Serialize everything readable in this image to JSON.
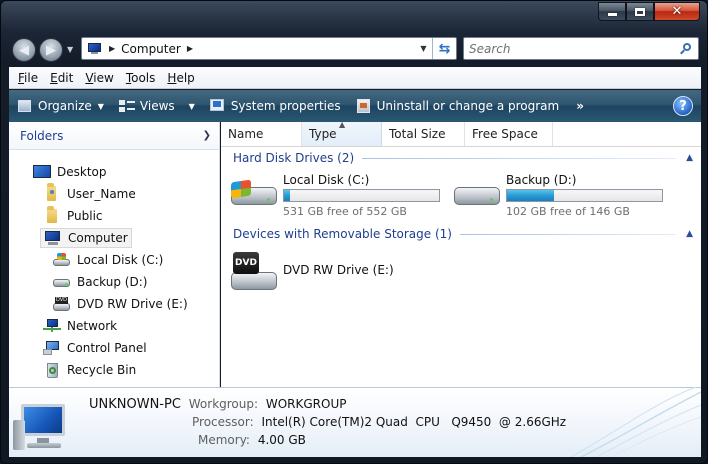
{
  "window": {
    "caption_buttons": [
      "minimize",
      "maximize",
      "close"
    ]
  },
  "address": {
    "crumbs": [
      "Computer"
    ],
    "search_placeholder": "Search"
  },
  "menu": {
    "items": [
      {
        "label": "File",
        "accel": "F",
        "rest": "ile"
      },
      {
        "label": "Edit",
        "accel": "E",
        "rest": "dit"
      },
      {
        "label": "View",
        "accel": "V",
        "rest": "iew"
      },
      {
        "label": "Tools",
        "accel": "T",
        "rest": "ools"
      },
      {
        "label": "Help",
        "accel": "H",
        "rest": "elp"
      }
    ]
  },
  "toolbar": {
    "organize": "Organize",
    "views": "Views",
    "system_properties": "System properties",
    "uninstall": "Uninstall or change a program",
    "more": "»",
    "help": "?"
  },
  "nav": {
    "header": "Folders",
    "items": [
      {
        "label": "Desktop",
        "icon": "desktop-icon"
      },
      {
        "label": "User_Name",
        "icon": "user-folder-icon"
      },
      {
        "label": "Public",
        "icon": "folder-icon"
      },
      {
        "label": "Computer",
        "icon": "computer-icon",
        "selected": true
      },
      {
        "label": "Local Disk (C:)",
        "icon": "windows-drive-icon"
      },
      {
        "label": "Backup (D:)",
        "icon": "hard-drive-icon"
      },
      {
        "label": "DVD RW Drive (E:)",
        "icon": "dvd-drive-icon"
      },
      {
        "label": "Network",
        "icon": "network-icon"
      },
      {
        "label": "Control Panel",
        "icon": "control-panel-icon"
      },
      {
        "label": "Recycle Bin",
        "icon": "recycle-bin-icon"
      }
    ]
  },
  "columns": [
    "Name",
    "Type",
    "Total Size",
    "Free Space"
  ],
  "groups": {
    "hdd": "Hard Disk Drives (2)",
    "removable": "Devices with Removable Storage (1)"
  },
  "drives": [
    {
      "name": "Local Disk (C:)",
      "free_text": "531 GB free of 552 GB",
      "used_fraction": 0.038
    },
    {
      "name": "Backup (D:)",
      "free_text": "102 GB free of 146 GB",
      "used_fraction": 0.301
    }
  ],
  "dvd": {
    "name": "DVD RW Drive (E:)",
    "badge": "DVD"
  },
  "details": {
    "pc_name": "UNKNOWN-PC",
    "workgroup_label": "Workgroup:",
    "workgroup": "WORKGROUP",
    "processor_label": "Processor:",
    "processor": "Intel(R) Core(TM)2 Quad  CPU   Q9450  @ 2.66GHz",
    "memory_label": "Memory:",
    "memory": "4.00 GB"
  },
  "colors": {
    "accent_blue": "#1e3f8f",
    "toolbar": "#2f5670",
    "bar_fill": "#2a9bd3"
  }
}
